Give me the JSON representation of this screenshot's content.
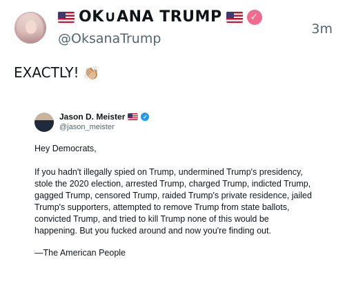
{
  "tweet": {
    "author_name": "OK∪ANA TRUMP",
    "handle": "@OksanaTrump",
    "timestamp": "3m",
    "text": "EXACTLY!",
    "emoji": "👏🏼"
  },
  "quoted": {
    "author_name": "Jason D. Meister",
    "handle": "@jason_meister",
    "greeting": "Hey Democrats,",
    "body_lines": [
      "If you hadn't illegally spied on Trump, undermined Trump's presidency,",
      "stole the 2020 election, arrested Trump, charged Trump, indicted Trump,",
      "gagged Trump, censored Trump, raided Trump's private residence, jailed",
      "Trump's supporters, attempted to remove Trump from state ballots,",
      "convicted Trump, and tried to kill Trump none of this would be",
      "happening. But you fucked around and now you're finding out."
    ],
    "signature": "—The American People"
  },
  "colors": {
    "text": "#0f1419",
    "secondary": "#536471",
    "verified_pink": "#f36a8f",
    "verified_blue": "#1d9bf0"
  },
  "icons": {
    "verified_author": "verified-badge-icon",
    "verified_quoted": "verified-badge-icon",
    "flags": "us-flag-icon"
  }
}
